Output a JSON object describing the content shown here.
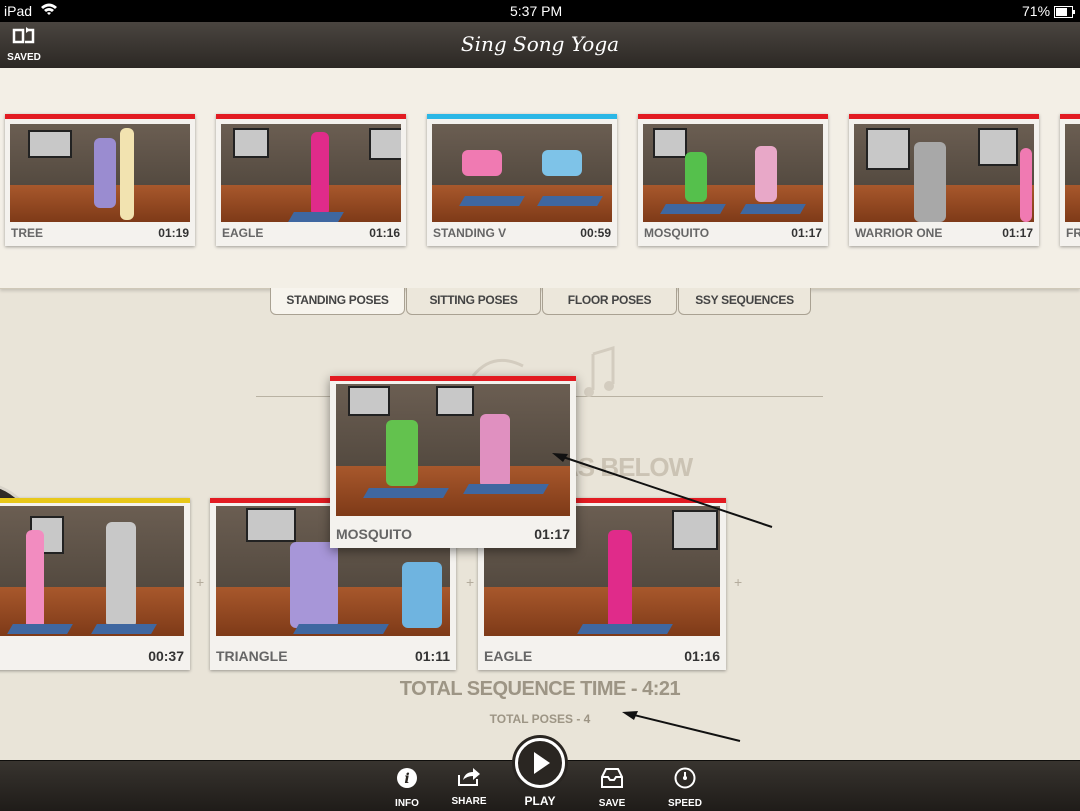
{
  "status": {
    "device": "iPad",
    "time": "5:37 PM",
    "battery": "71%"
  },
  "header": {
    "title": "Sing Song Yoga",
    "saved_label": "SAVED"
  },
  "library": [
    {
      "name": "TREE",
      "duration": "01:19",
      "bar_color": "#e21b22"
    },
    {
      "name": "EAGLE",
      "duration": "01:16",
      "bar_color": "#e21b22"
    },
    {
      "name": "STANDING V",
      "duration": "00:59",
      "bar_color": "#2bb7e6"
    },
    {
      "name": "MOSQUITO",
      "duration": "01:17",
      "bar_color": "#e21b22"
    },
    {
      "name": "WARRIOR ONE",
      "duration": "01:17",
      "bar_color": "#e21b22"
    },
    {
      "name": "FR",
      "duration": "",
      "bar_color": "#e21b22"
    }
  ],
  "tabs": [
    "STANDING POSES",
    "SITTING POSES",
    "FLOOR POSES",
    "SSY SEQUENCES"
  ],
  "drop_hint": "AS BELOW",
  "dragging": {
    "name": "MOSQUITO",
    "duration": "01:17",
    "bar_color": "#e21b22"
  },
  "sequence": [
    {
      "name": "N",
      "duration": "00:37",
      "bar_color": "#e8c81a"
    },
    {
      "name": "TRIANGLE",
      "duration": "01:11",
      "bar_color": "#e21b22"
    },
    {
      "name": "EAGLE",
      "duration": "01:16",
      "bar_color": "#e21b22"
    }
  ],
  "totals": {
    "time": "TOTAL SEQUENCE TIME - 4:21",
    "poses": "TOTAL POSES - 4"
  },
  "toolbar": {
    "info": "INFO",
    "share": "SHARE",
    "play": "PLAY",
    "save": "SAVE",
    "speed": "SPEED"
  }
}
